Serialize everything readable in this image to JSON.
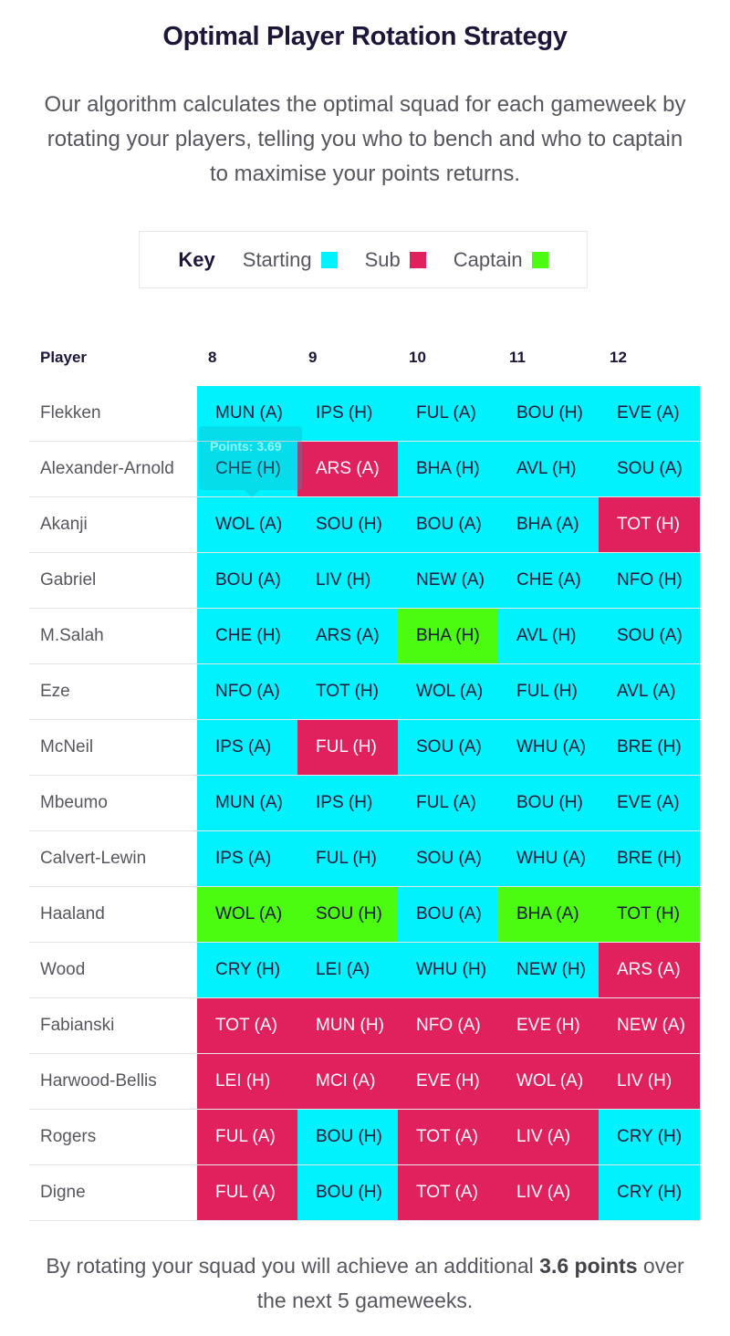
{
  "header": {
    "title": "Optimal Player Rotation Strategy",
    "intro": "Our algorithm calculates the optimal squad for each gameweek by rotating your players, telling you who to bench and who to captain to maximise your points returns."
  },
  "key": {
    "label": "Key",
    "items": [
      {
        "label": "Starting",
        "color": "#00f2fd"
      },
      {
        "label": "Sub",
        "color": "#e0215e"
      },
      {
        "label": "Captain",
        "color": "#4bfc11"
      }
    ]
  },
  "table": {
    "player_header": "Player",
    "gameweeks": [
      "8",
      "9",
      "10",
      "11",
      "12"
    ],
    "rows": [
      {
        "player": "Flekken",
        "fixtures": [
          {
            "text": "MUN (A)",
            "status": "starting"
          },
          {
            "text": "IPS (H)",
            "status": "starting"
          },
          {
            "text": "FUL (A)",
            "status": "starting"
          },
          {
            "text": "BOU (H)",
            "status": "starting"
          },
          {
            "text": "EVE (A)",
            "status": "starting"
          }
        ]
      },
      {
        "player": "Alexander-Arnold",
        "fixtures": [
          {
            "text": "CHE (H)",
            "status": "starting"
          },
          {
            "text": "ARS (A)",
            "status": "sub"
          },
          {
            "text": "BHA (H)",
            "status": "starting"
          },
          {
            "text": "AVL (H)",
            "status": "starting"
          },
          {
            "text": "SOU (A)",
            "status": "starting"
          }
        ]
      },
      {
        "player": "Akanji",
        "fixtures": [
          {
            "text": "WOL (A)",
            "status": "starting"
          },
          {
            "text": "SOU (H)",
            "status": "starting"
          },
          {
            "text": "BOU (A)",
            "status": "starting"
          },
          {
            "text": "BHA (A)",
            "status": "starting"
          },
          {
            "text": "TOT (H)",
            "status": "sub"
          }
        ]
      },
      {
        "player": "Gabriel",
        "fixtures": [
          {
            "text": "BOU (A)",
            "status": "starting"
          },
          {
            "text": "LIV (H)",
            "status": "starting"
          },
          {
            "text": "NEW (A)",
            "status": "starting"
          },
          {
            "text": "CHE (A)",
            "status": "starting"
          },
          {
            "text": "NFO (H)",
            "status": "starting"
          }
        ]
      },
      {
        "player": "M.Salah",
        "fixtures": [
          {
            "text": "CHE (H)",
            "status": "starting"
          },
          {
            "text": "ARS (A)",
            "status": "starting"
          },
          {
            "text": "BHA (H)",
            "status": "captain"
          },
          {
            "text": "AVL (H)",
            "status": "starting"
          },
          {
            "text": "SOU (A)",
            "status": "starting"
          }
        ]
      },
      {
        "player": "Eze",
        "fixtures": [
          {
            "text": "NFO (A)",
            "status": "starting"
          },
          {
            "text": "TOT (H)",
            "status": "starting"
          },
          {
            "text": "WOL (A)",
            "status": "starting"
          },
          {
            "text": "FUL (H)",
            "status": "starting"
          },
          {
            "text": "AVL (A)",
            "status": "starting"
          }
        ]
      },
      {
        "player": "McNeil",
        "fixtures": [
          {
            "text": "IPS (A)",
            "status": "starting"
          },
          {
            "text": "FUL (H)",
            "status": "sub"
          },
          {
            "text": "SOU (A)",
            "status": "starting"
          },
          {
            "text": "WHU (A)",
            "status": "starting"
          },
          {
            "text": "BRE (H)",
            "status": "starting"
          }
        ]
      },
      {
        "player": "Mbeumo",
        "fixtures": [
          {
            "text": "MUN (A)",
            "status": "starting"
          },
          {
            "text": "IPS (H)",
            "status": "starting"
          },
          {
            "text": "FUL (A)",
            "status": "starting"
          },
          {
            "text": "BOU (H)",
            "status": "starting"
          },
          {
            "text": "EVE (A)",
            "status": "starting"
          }
        ]
      },
      {
        "player": "Calvert-Lewin",
        "fixtures": [
          {
            "text": "IPS (A)",
            "status": "starting"
          },
          {
            "text": "FUL (H)",
            "status": "starting"
          },
          {
            "text": "SOU (A)",
            "status": "starting"
          },
          {
            "text": "WHU (A)",
            "status": "starting"
          },
          {
            "text": "BRE (H)",
            "status": "starting"
          }
        ]
      },
      {
        "player": "Haaland",
        "fixtures": [
          {
            "text": "WOL (A)",
            "status": "captain"
          },
          {
            "text": "SOU (H)",
            "status": "captain"
          },
          {
            "text": "BOU (A)",
            "status": "starting"
          },
          {
            "text": "BHA (A)",
            "status": "captain"
          },
          {
            "text": "TOT (H)",
            "status": "captain"
          }
        ]
      },
      {
        "player": "Wood",
        "fixtures": [
          {
            "text": "CRY (H)",
            "status": "starting"
          },
          {
            "text": "LEI (A)",
            "status": "starting"
          },
          {
            "text": "WHU (H)",
            "status": "starting"
          },
          {
            "text": "NEW (H)",
            "status": "starting"
          },
          {
            "text": "ARS (A)",
            "status": "sub"
          }
        ]
      },
      {
        "player": "Fabianski",
        "fixtures": [
          {
            "text": "TOT (A)",
            "status": "sub"
          },
          {
            "text": "MUN (H)",
            "status": "sub"
          },
          {
            "text": "NFO (A)",
            "status": "sub"
          },
          {
            "text": "EVE (H)",
            "status": "sub"
          },
          {
            "text": "NEW (A)",
            "status": "sub"
          }
        ]
      },
      {
        "player": "Harwood-Bellis",
        "fixtures": [
          {
            "text": "LEI (H)",
            "status": "sub"
          },
          {
            "text": "MCI (A)",
            "status": "sub"
          },
          {
            "text": "EVE (H)",
            "status": "sub"
          },
          {
            "text": "WOL (A)",
            "status": "sub"
          },
          {
            "text": "LIV (H)",
            "status": "sub"
          }
        ]
      },
      {
        "player": "Rogers",
        "fixtures": [
          {
            "text": "FUL (A)",
            "status": "sub"
          },
          {
            "text": "BOU (H)",
            "status": "starting"
          },
          {
            "text": "TOT (A)",
            "status": "sub"
          },
          {
            "text": "LIV (A)",
            "status": "sub"
          },
          {
            "text": "CRY (H)",
            "status": "starting"
          }
        ]
      },
      {
        "player": "Digne",
        "fixtures": [
          {
            "text": "FUL (A)",
            "status": "sub"
          },
          {
            "text": "BOU (H)",
            "status": "starting"
          },
          {
            "text": "TOT (A)",
            "status": "sub"
          },
          {
            "text": "LIV (A)",
            "status": "sub"
          },
          {
            "text": "CRY (H)",
            "status": "starting"
          }
        ]
      }
    ]
  },
  "tooltip": {
    "text": "Points: 3.69"
  },
  "summary": {
    "prefix": "By rotating your squad you will achieve an additional ",
    "highlight": "3.6 points",
    "suffix": " over the next 5 gameweeks."
  }
}
